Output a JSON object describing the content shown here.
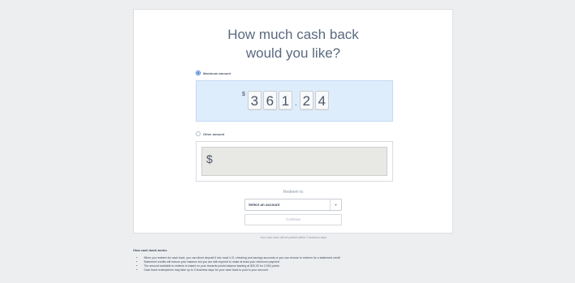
{
  "card": {
    "title_line1": "How much cash back",
    "title_line2": "would you like?",
    "maximum": {
      "label": "Maximum amount",
      "selected": true,
      "currency_symbol": "$",
      "digits": [
        "3",
        "6",
        "1",
        "2",
        "4"
      ],
      "decimal": "."
    },
    "other": {
      "label": "Other amount",
      "selected": false,
      "currency_symbol": "$",
      "value": ""
    },
    "redeem_to_label": "Redeem to",
    "account_select": {
      "selected_text": "Select an account",
      "caret_icon": "chevron-down-icon"
    },
    "continue_label": "Continue",
    "posted_note": "Your cash back will be posted within 3 business days"
  },
  "how_it_works": {
    "title": "How cash back works",
    "items": [
      "When you redeem for cash back, you can direct deposit it into most U.S. checking and savings accounts or you can choose to redeem for a statement credit",
      "Statement credits will reduce your balance but you are still required to make at least your minimum payment",
      "The amount available to redeem is based on your rewards points balance starting at $20.00 for 2,000 points",
      "Cash back redemptions may take up to 3 business days for your cash back to post to your account"
    ]
  },
  "colors": {
    "accent": "#3a7bd5",
    "max_box_bg": "#deedfc",
    "input_bg": "#e8e8e4"
  }
}
